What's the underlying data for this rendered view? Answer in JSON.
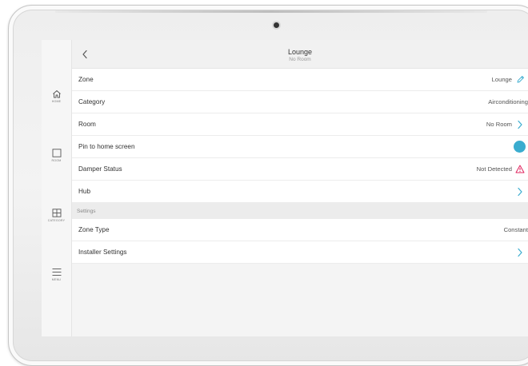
{
  "header": {
    "title": "Lounge",
    "subtitle": "No Room"
  },
  "sidebar": {
    "items": [
      {
        "label": "HOME",
        "icon": "home-icon"
      },
      {
        "label": "ROOM",
        "icon": "room-square-icon"
      },
      {
        "label": "CATEGORY",
        "icon": "grid-icon"
      },
      {
        "label": "MENU",
        "icon": "hamburger-menu-icon"
      }
    ]
  },
  "rows": {
    "zone": {
      "label": "Zone",
      "value": "Lounge",
      "icon": "pencil-edit-icon"
    },
    "category": {
      "label": "Category",
      "value": "Airconditioning"
    },
    "room": {
      "label": "Room",
      "value": "No Room",
      "icon": "chevron-right-icon"
    },
    "pin": {
      "label": "Pin to home screen",
      "toggle": true
    },
    "damper": {
      "label": "Damper Status",
      "value": "Not Detected",
      "icon": "warning-triangle-icon"
    },
    "hub": {
      "label": "Hub",
      "icon": "chevron-right-icon"
    }
  },
  "settings": {
    "section_title": "Settings",
    "zone_type": {
      "label": "Zone Type",
      "value": "Constant"
    },
    "installer": {
      "label": "Installer Settings",
      "icon": "chevron-right-icon"
    }
  },
  "colors": {
    "accent": "#3aaccf",
    "warning": "#e0245e",
    "background": "#f4f4f4"
  }
}
